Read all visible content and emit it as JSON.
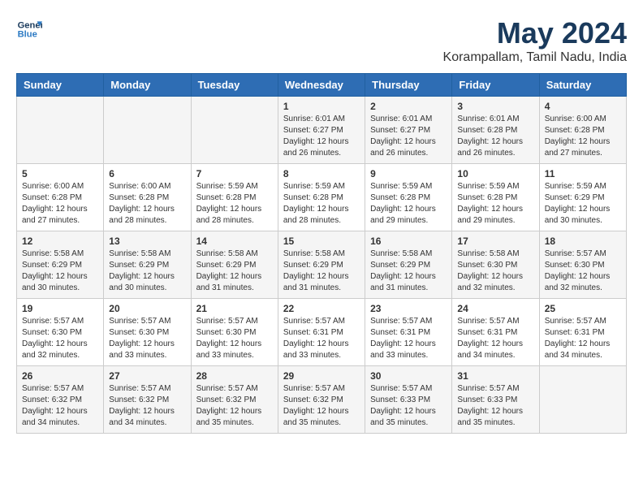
{
  "header": {
    "logo_line1": "General",
    "logo_line2": "Blue",
    "month_year": "May 2024",
    "location": "Korampallam, Tamil Nadu, India"
  },
  "weekdays": [
    "Sunday",
    "Monday",
    "Tuesday",
    "Wednesday",
    "Thursday",
    "Friday",
    "Saturday"
  ],
  "weeks": [
    [
      {
        "day": "",
        "info": ""
      },
      {
        "day": "",
        "info": ""
      },
      {
        "day": "",
        "info": ""
      },
      {
        "day": "1",
        "info": "Sunrise: 6:01 AM\nSunset: 6:27 PM\nDaylight: 12 hours\nand 26 minutes."
      },
      {
        "day": "2",
        "info": "Sunrise: 6:01 AM\nSunset: 6:27 PM\nDaylight: 12 hours\nand 26 minutes."
      },
      {
        "day": "3",
        "info": "Sunrise: 6:01 AM\nSunset: 6:28 PM\nDaylight: 12 hours\nand 26 minutes."
      },
      {
        "day": "4",
        "info": "Sunrise: 6:00 AM\nSunset: 6:28 PM\nDaylight: 12 hours\nand 27 minutes."
      }
    ],
    [
      {
        "day": "5",
        "info": "Sunrise: 6:00 AM\nSunset: 6:28 PM\nDaylight: 12 hours\nand 27 minutes."
      },
      {
        "day": "6",
        "info": "Sunrise: 6:00 AM\nSunset: 6:28 PM\nDaylight: 12 hours\nand 28 minutes."
      },
      {
        "day": "7",
        "info": "Sunrise: 5:59 AM\nSunset: 6:28 PM\nDaylight: 12 hours\nand 28 minutes."
      },
      {
        "day": "8",
        "info": "Sunrise: 5:59 AM\nSunset: 6:28 PM\nDaylight: 12 hours\nand 28 minutes."
      },
      {
        "day": "9",
        "info": "Sunrise: 5:59 AM\nSunset: 6:28 PM\nDaylight: 12 hours\nand 29 minutes."
      },
      {
        "day": "10",
        "info": "Sunrise: 5:59 AM\nSunset: 6:28 PM\nDaylight: 12 hours\nand 29 minutes."
      },
      {
        "day": "11",
        "info": "Sunrise: 5:59 AM\nSunset: 6:29 PM\nDaylight: 12 hours\nand 30 minutes."
      }
    ],
    [
      {
        "day": "12",
        "info": "Sunrise: 5:58 AM\nSunset: 6:29 PM\nDaylight: 12 hours\nand 30 minutes."
      },
      {
        "day": "13",
        "info": "Sunrise: 5:58 AM\nSunset: 6:29 PM\nDaylight: 12 hours\nand 30 minutes."
      },
      {
        "day": "14",
        "info": "Sunrise: 5:58 AM\nSunset: 6:29 PM\nDaylight: 12 hours\nand 31 minutes."
      },
      {
        "day": "15",
        "info": "Sunrise: 5:58 AM\nSunset: 6:29 PM\nDaylight: 12 hours\nand 31 minutes."
      },
      {
        "day": "16",
        "info": "Sunrise: 5:58 AM\nSunset: 6:29 PM\nDaylight: 12 hours\nand 31 minutes."
      },
      {
        "day": "17",
        "info": "Sunrise: 5:58 AM\nSunset: 6:30 PM\nDaylight: 12 hours\nand 32 minutes."
      },
      {
        "day": "18",
        "info": "Sunrise: 5:57 AM\nSunset: 6:30 PM\nDaylight: 12 hours\nand 32 minutes."
      }
    ],
    [
      {
        "day": "19",
        "info": "Sunrise: 5:57 AM\nSunset: 6:30 PM\nDaylight: 12 hours\nand 32 minutes."
      },
      {
        "day": "20",
        "info": "Sunrise: 5:57 AM\nSunset: 6:30 PM\nDaylight: 12 hours\nand 33 minutes."
      },
      {
        "day": "21",
        "info": "Sunrise: 5:57 AM\nSunset: 6:30 PM\nDaylight: 12 hours\nand 33 minutes."
      },
      {
        "day": "22",
        "info": "Sunrise: 5:57 AM\nSunset: 6:31 PM\nDaylight: 12 hours\nand 33 minutes."
      },
      {
        "day": "23",
        "info": "Sunrise: 5:57 AM\nSunset: 6:31 PM\nDaylight: 12 hours\nand 33 minutes."
      },
      {
        "day": "24",
        "info": "Sunrise: 5:57 AM\nSunset: 6:31 PM\nDaylight: 12 hours\nand 34 minutes."
      },
      {
        "day": "25",
        "info": "Sunrise: 5:57 AM\nSunset: 6:31 PM\nDaylight: 12 hours\nand 34 minutes."
      }
    ],
    [
      {
        "day": "26",
        "info": "Sunrise: 5:57 AM\nSunset: 6:32 PM\nDaylight: 12 hours\nand 34 minutes."
      },
      {
        "day": "27",
        "info": "Sunrise: 5:57 AM\nSunset: 6:32 PM\nDaylight: 12 hours\nand 34 minutes."
      },
      {
        "day": "28",
        "info": "Sunrise: 5:57 AM\nSunset: 6:32 PM\nDaylight: 12 hours\nand 35 minutes."
      },
      {
        "day": "29",
        "info": "Sunrise: 5:57 AM\nSunset: 6:32 PM\nDaylight: 12 hours\nand 35 minutes."
      },
      {
        "day": "30",
        "info": "Sunrise: 5:57 AM\nSunset: 6:33 PM\nDaylight: 12 hours\nand 35 minutes."
      },
      {
        "day": "31",
        "info": "Sunrise: 5:57 AM\nSunset: 6:33 PM\nDaylight: 12 hours\nand 35 minutes."
      },
      {
        "day": "",
        "info": ""
      }
    ]
  ]
}
